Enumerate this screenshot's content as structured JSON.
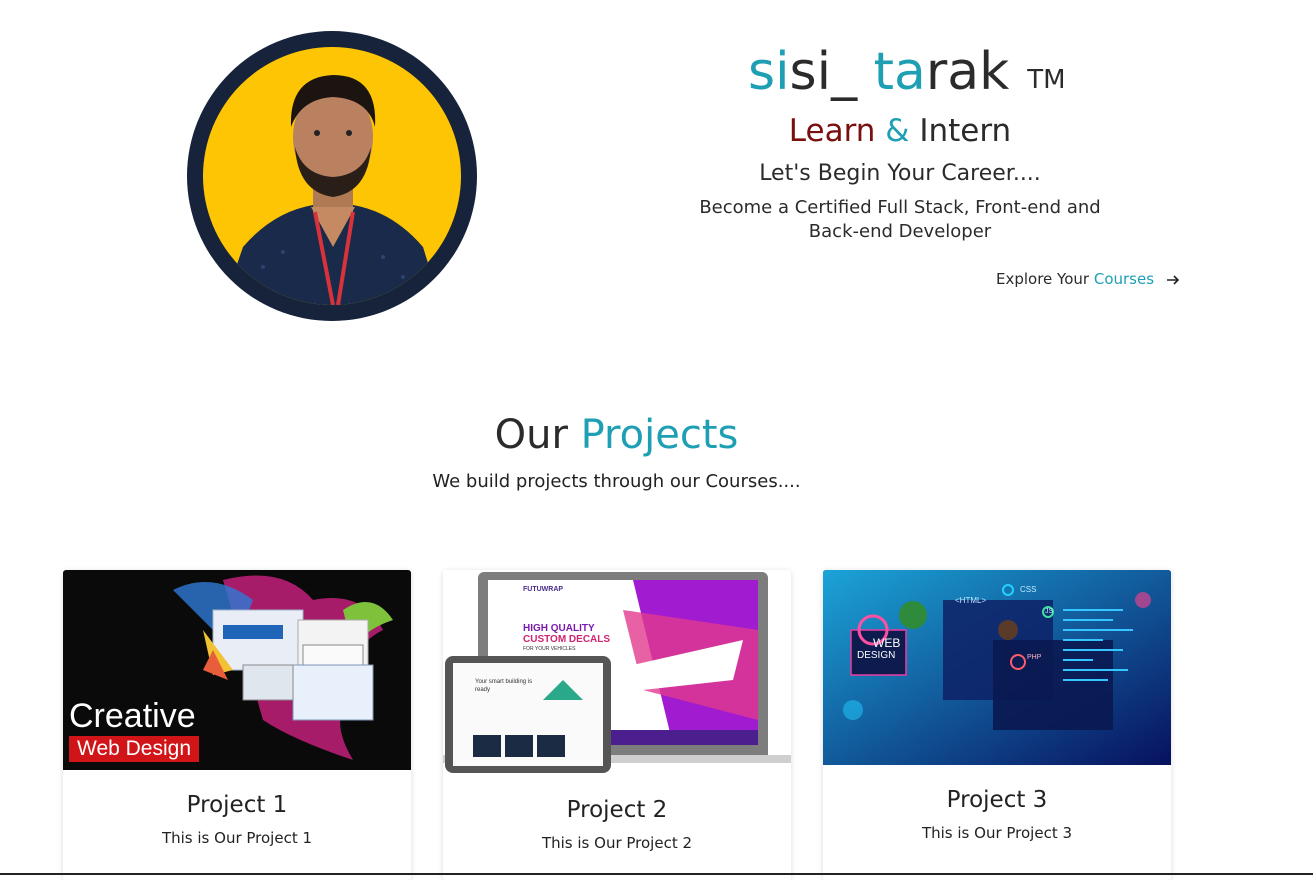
{
  "hero": {
    "brand_part1": "si",
    "brand_part2": "si_ ",
    "brand_part3": "ta",
    "brand_part4": "rak",
    "trademark": "TM",
    "tagline_learn": "Learn",
    "tagline_amp": "&",
    "tagline_intern": "Intern",
    "subline": "Let's Begin Your Career....",
    "description": "Become a Certified Full Stack, Front-end and Back-end Developer",
    "explore_prefix": "Explore Your",
    "explore_link": "Courses",
    "explore_icon": "arrow-right-icon"
  },
  "projects": {
    "title_part1": "Our",
    "title_part2": "Projects",
    "subtitle": "We build projects through our Courses....",
    "cards": [
      {
        "title": "Project 1",
        "text": "This is Our Project 1",
        "banner_line1": "Creative",
        "banner_line2": "Web Design"
      },
      {
        "title": "Project 2",
        "text": "This is Our Project 2",
        "hero_line1": "HIGH QUALITY",
        "hero_line2": "CUSTOM DECALS",
        "hero_line3": "FOR YOUR VEHICLES",
        "logo": "FUTUWRAP",
        "tablet_text": "Your smart building is ready"
      },
      {
        "title": "Project 3",
        "text": "This is Our Project 3",
        "tag_web": "WEB",
        "tag_design": "DESIGN",
        "tag_html": "<HTML>",
        "tag_css": "CSS",
        "tag_js": "JS",
        "tag_php": "PHP"
      }
    ]
  },
  "colors": {
    "accent": "#1e9fb3",
    "maroon": "#7a0f0f",
    "avatar_ring": "#16233a",
    "avatar_bg": "#fdc503"
  }
}
